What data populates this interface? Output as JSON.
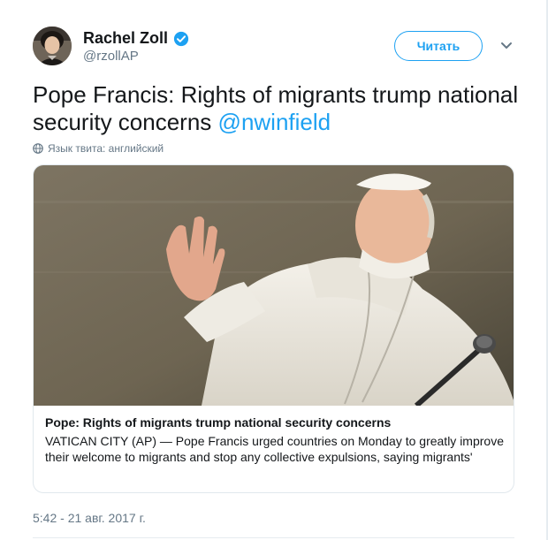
{
  "author": {
    "name": "Rachel Zoll",
    "handle": "@rzollAP",
    "verified": true
  },
  "follow_button_label": "Читать",
  "tweet": {
    "text": "Pope Francis: Rights of migrants trump national security concerns",
    "mention": "@nwinfield",
    "language_label": "Язык твита: английский"
  },
  "card": {
    "title": "Pope: Rights of migrants trump national security concerns",
    "description": "VATICAN CITY (AP) — Pope Francis urged countries on Monday to greatly improve their welcome to migrants and stop any collective expulsions, saying migrants'"
  },
  "timestamp": "5:42 - 21 авг. 2017 г.",
  "colors": {
    "accent": "#1da1f2",
    "secondary_text": "#657786",
    "border": "#e1e8ed"
  },
  "icons": [
    "verified-badge-icon",
    "chevron-down-icon",
    "globe-icon"
  ]
}
